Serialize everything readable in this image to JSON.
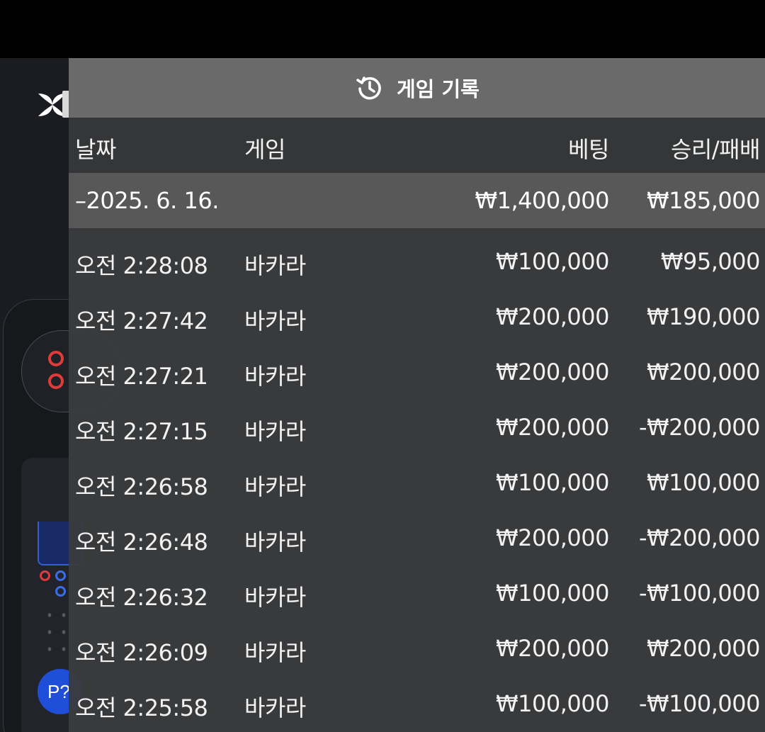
{
  "header": {
    "title": "게임 기록",
    "icon": "history-icon"
  },
  "columns": {
    "date": "날짜",
    "game": "게임",
    "bet": "베팅",
    "result": "승리/패배"
  },
  "date_group": {
    "label": "–2025. 6. 16.",
    "total_bet": "₩1,400,000",
    "total_result": "₩185,000"
  },
  "rows": [
    {
      "time": "오전 2:28:08",
      "game": "바카라",
      "bet": "₩100,000",
      "result": "₩95,000"
    },
    {
      "time": "오전 2:27:42",
      "game": "바카라",
      "bet": "₩200,000",
      "result": "₩190,000"
    },
    {
      "time": "오전 2:27:21",
      "game": "바카라",
      "bet": "₩200,000",
      "result": "₩200,000"
    },
    {
      "time": "오전 2:27:15",
      "game": "바카라",
      "bet": "₩200,000",
      "result": "-₩200,000"
    },
    {
      "time": "오전 2:26:58",
      "game": "바카라",
      "bet": "₩100,000",
      "result": "₩100,000"
    },
    {
      "time": "오전 2:26:48",
      "game": "바카라",
      "bet": "₩200,000",
      "result": "-₩200,000"
    },
    {
      "time": "오전 2:26:32",
      "game": "바카라",
      "bet": "₩100,000",
      "result": "-₩100,000"
    },
    {
      "time": "오전 2:26:09",
      "game": "바카라",
      "bet": "₩200,000",
      "result": "₩200,000"
    },
    {
      "time": "오전 2:25:58",
      "game": "바카라",
      "bet": "₩100,000",
      "result": "-₩100,000"
    }
  ],
  "background_app": {
    "p_button_label": "P?"
  }
}
